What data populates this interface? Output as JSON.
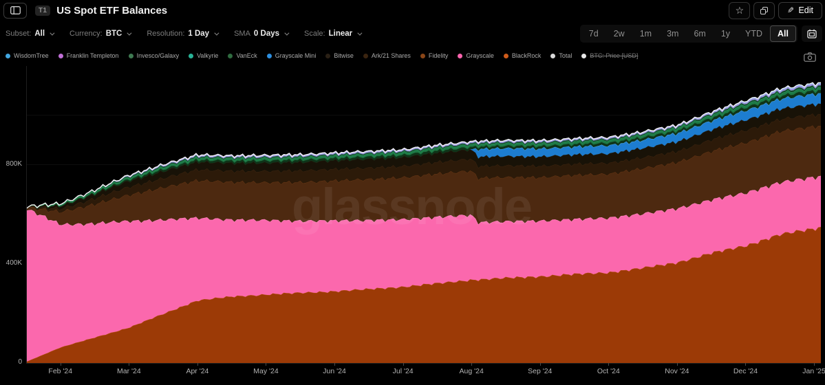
{
  "header": {
    "tag": "T1",
    "title": "US Spot ETF Balances",
    "edit_label": "Edit"
  },
  "filters": [
    {
      "label": "Subset:",
      "value": "All"
    },
    {
      "label": "Currency:",
      "value": "BTC"
    },
    {
      "label": "Resolution:",
      "value": "1 Day"
    },
    {
      "label": "SMA",
      "value": "0 Days"
    },
    {
      "label": "Scale:",
      "value": "Linear"
    }
  ],
  "ranges": {
    "options": [
      "7d",
      "2w",
      "1m",
      "3m",
      "6m",
      "1y",
      "YTD",
      "All"
    ],
    "selected": "All"
  },
  "legend": [
    {
      "label": "WisdomTree",
      "color": "#41a6e0",
      "disabled": false
    },
    {
      "label": "Franklin Templeton",
      "color": "#c06fd6",
      "disabled": false
    },
    {
      "label": "Invesco/Galaxy",
      "color": "#3f7a52",
      "disabled": false
    },
    {
      "label": "Valkyrie",
      "color": "#28b296",
      "disabled": false
    },
    {
      "label": "VanEck",
      "color": "#2f6b3f",
      "disabled": false
    },
    {
      "label": "Grayscale Mini",
      "color": "#2d8fe0",
      "disabled": false
    },
    {
      "label": "Bitwise",
      "color": "#2a2015",
      "disabled": false
    },
    {
      "label": "Ark/21 Shares",
      "color": "#3a2410",
      "disabled": false
    },
    {
      "label": "Fidelity",
      "color": "#8a4517",
      "disabled": false
    },
    {
      "label": "Grayscale",
      "color": "#fa64ae",
      "disabled": false
    },
    {
      "label": "BlackRock",
      "color": "#cf5b1a",
      "disabled": false
    },
    {
      "label": "Total",
      "color": "#d9d9d9",
      "disabled": false
    },
    {
      "label": "BTC: Price [USD]",
      "color": "#e8e8e8",
      "disabled": true
    }
  ],
  "watermark": "glassnode",
  "chart_data": {
    "type": "area",
    "stacked": true,
    "title": "US Spot ETF Balances",
    "unit": "BTC (thousands)",
    "x_unit": "months since 2024-01-01",
    "x_range": [
      0.5,
      12.1
    ],
    "y_range": [
      0,
      1160
    ],
    "grid_step": 200,
    "x": [
      0.5,
      1,
      1.5,
      2,
      2.5,
      3,
      3.5,
      4,
      4.5,
      5,
      5.5,
      6,
      6.5,
      7,
      7.1,
      7.5,
      8,
      8.5,
      9,
      9.5,
      10,
      10.5,
      11,
      11.5,
      12,
      12.1
    ],
    "x_ticks": [
      {
        "t": 1,
        "label": "Feb '24"
      },
      {
        "t": 2,
        "label": "Mar '24"
      },
      {
        "t": 3,
        "label": "Apr '24"
      },
      {
        "t": 4,
        "label": "May '24"
      },
      {
        "t": 5,
        "label": "Jun '24"
      },
      {
        "t": 6,
        "label": "Jul '24"
      },
      {
        "t": 7,
        "label": "Aug '24"
      },
      {
        "t": 8,
        "label": "Sep '24"
      },
      {
        "t": 9,
        "label": "Oct '24"
      },
      {
        "t": 10,
        "label": "Nov '24"
      },
      {
        "t": 11,
        "label": "Dec '24"
      },
      {
        "t": 12,
        "label": "Jan '25"
      }
    ],
    "y_ticks": [
      {
        "v": 0,
        "label": "0"
      },
      {
        "v": 400,
        "label": "400K"
      },
      {
        "v": 800,
        "label": "800K"
      }
    ],
    "series": [
      {
        "name": "BlackRock",
        "fill": "#9c3a06",
        "stroke": "#b5500f",
        "values": [
          2,
          60,
          100,
          140,
          195,
          250,
          265,
          274,
          280,
          287,
          295,
          305,
          318,
          333,
          334,
          340,
          347,
          355,
          363,
          380,
          403,
          440,
          471,
          515,
          540,
          545
        ]
      },
      {
        "name": "Grayscale",
        "fill": "#fb68ad",
        "stroke": "#ff90c6",
        "values": [
          617,
          497,
          460,
          430,
          380,
          333,
          310,
          300,
          290,
          285,
          278,
          272,
          268,
          262,
          231,
          228,
          224,
          222,
          220,
          219,
          218,
          215,
          213,
          210,
          207,
          206
        ]
      },
      {
        "name": "Fidelity",
        "fill": "#4d2910",
        "stroke": "#663614",
        "values": [
          5,
          50,
          78,
          105,
          130,
          151,
          152,
          152,
          156,
          161,
          165,
          169,
          174,
          179,
          179,
          178,
          176,
          177,
          178,
          182,
          187,
          195,
          203,
          205,
          205,
          205
        ]
      },
      {
        "name": "Ark/21 Shares",
        "fill": "#2c1a09",
        "stroke": "#3d2510",
        "values": [
          1,
          13,
          23,
          33,
          38,
          44,
          45,
          46,
          47,
          47,
          46,
          46,
          47,
          48,
          48,
          47,
          46,
          45,
          44,
          44,
          44,
          47,
          50,
          49,
          48,
          47
        ]
      },
      {
        "name": "Bitwise",
        "fill": "#181207",
        "stroke": "#272011",
        "values": [
          1,
          11,
          18,
          24,
          28,
          31,
          32,
          33,
          34,
          35,
          36,
          36,
          37,
          38,
          38,
          38,
          38,
          38,
          38,
          38,
          39,
          40,
          42,
          42,
          42,
          42
        ]
      },
      {
        "name": "Grayscale Mini",
        "fill": "#1d7dd0",
        "stroke": "#55aae8",
        "values": [
          0,
          0,
          0,
          0,
          0,
          0,
          0,
          0,
          0,
          0,
          0,
          0,
          0,
          0,
          31,
          32,
          32,
          32,
          33,
          33,
          34,
          36,
          38,
          40,
          41,
          42
        ]
      },
      {
        "name": "VanEck",
        "fill": "#0e3419",
        "stroke": "#1a5c30",
        "values": [
          0.3,
          3,
          5,
          7,
          8.5,
          9,
          9.5,
          10,
          10,
          10,
          10,
          10,
          10.5,
          10.5,
          10.5,
          10.5,
          11,
          11,
          11,
          11,
          11,
          12,
          13,
          13.5,
          14,
          14
        ]
      },
      {
        "name": "Valkyrie",
        "fill": "#1d7a46",
        "stroke": "#2fa868",
        "values": [
          0.3,
          3,
          5,
          7,
          8,
          8.5,
          8.5,
          9,
          9,
          9,
          9,
          9,
          9.5,
          9.5,
          9.5,
          9.5,
          10,
          10,
          10,
          10,
          10,
          10.5,
          11,
          11,
          11,
          11
        ]
      },
      {
        "name": "Invesco/Galaxy",
        "fill": "#16452a",
        "stroke": "#27784a",
        "values": [
          0.2,
          2,
          3.5,
          4.5,
          5,
          5,
          5,
          5,
          5,
          5,
          5,
          5,
          5,
          5,
          5,
          5,
          5,
          5,
          5,
          5,
          5,
          5.5,
          6,
          6.5,
          7,
          7
        ]
      },
      {
        "name": "Franklin Templeton",
        "fill": "#9b8ede",
        "stroke": "#c7bcf2",
        "values": [
          0.1,
          1,
          2,
          3.5,
          4.5,
          5,
          5,
          5,
          5,
          5,
          5,
          5,
          5,
          5,
          5,
          5,
          5,
          5,
          5,
          5,
          5,
          5.5,
          6.5,
          7,
          7,
          7
        ]
      },
      {
        "name": "WisdomTree",
        "fill": "#3fa0e8",
        "stroke": "#7cc4f5",
        "values": [
          0.1,
          0.3,
          0.6,
          1,
          1.2,
          1.5,
          1.5,
          2,
          2,
          2,
          2,
          2,
          2,
          2,
          2,
          2,
          2,
          2,
          2,
          2,
          2,
          2.5,
          3,
          3.5,
          3.5,
          3.5
        ]
      }
    ],
    "total_line": {
      "name": "Total",
      "color": "#f2f2f2"
    }
  }
}
